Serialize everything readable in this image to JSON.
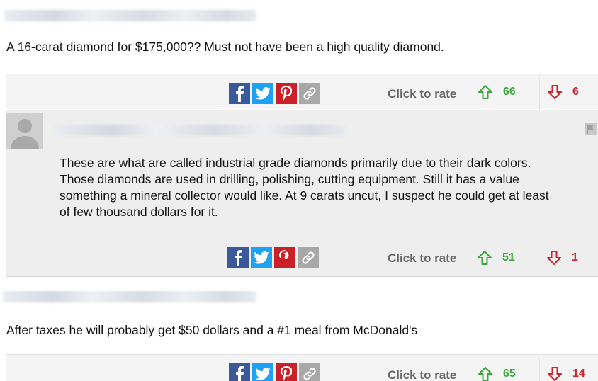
{
  "comments": [
    {
      "text": "A 16-carat diamond for $175,000?? Must not have been a high quality diamond.",
      "rate_label": "Click to rate",
      "up_votes": "66",
      "down_votes": "6"
    },
    {
      "text_lines": [
        "These are what are called industrial grade diamonds primarily due to their dark colors.",
        "Those diamonds are used in drilling, polishing, cutting equipment. Still it has a value",
        "something a mineral collector would like. At 9 carats uncut, I suspect he could get at least",
        "of few thousand dollars for it."
      ],
      "rate_label": "Click to rate",
      "up_votes": "51",
      "down_votes": "1"
    },
    {
      "text": "After taxes he will probably get $50 dollars and a #1 meal from McDonald's",
      "rate_label": "Click to rate",
      "up_votes": "65",
      "down_votes": "14"
    }
  ],
  "icons": {
    "facebook": "facebook-icon",
    "twitter": "twitter-icon",
    "pinterest": "pinterest-icon",
    "link": "link-icon",
    "upvote": "arrow-up-icon",
    "downvote": "arrow-down-icon",
    "flag": "flag-icon",
    "avatar": "default-avatar"
  },
  "colors": {
    "facebook": "#3b5998",
    "twitter": "#1da1f2",
    "pinterest": "#cb2027",
    "link": "#a8a8a8",
    "up": "#3aa53a",
    "down": "#d0202a",
    "rate_label": "#666666"
  }
}
